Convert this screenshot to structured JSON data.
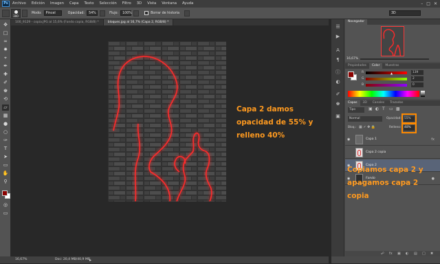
{
  "app": {
    "logo": "Ps"
  },
  "menu": [
    "Archivo",
    "Edición",
    "Imagen",
    "Capa",
    "Texto",
    "Selección",
    "Filtro",
    "3D",
    "Vista",
    "Ventana",
    "Ayuda"
  ],
  "options": {
    "brush_size": "300",
    "mode_label": "Modo:",
    "mode_value": "Pincel",
    "opacity_label": "Opacidad:",
    "opacity_value": "54%",
    "flow_label": "Flujo:",
    "flow_value": "100%",
    "erase_history_label": "Borrar de historia",
    "workspace_value": "3D"
  },
  "tabs": [
    {
      "label": "100_9129 - copia.JPG al 15,6% (Fondo copia, RGB/8) *"
    },
    {
      "label": "bloques.jpg al 16,7% (Capa 2, RGB/8) *"
    }
  ],
  "status": {
    "zoom": "16,67%",
    "doc": "Doc: 20,4 MB/40,9 MB"
  },
  "annotations": {
    "top": [
      "Capa 2 damos",
      "opacidad de 55% y",
      "relleno 40%"
    ],
    "bottom": [
      "Copiamos capa 2 y",
      "apagamos capa 2",
      "copia"
    ]
  },
  "navigator": {
    "title": "Navegador",
    "zoom": "16,67%"
  },
  "color_panel": {
    "tabs": [
      "Propiedades",
      "Color",
      "Muestras"
    ],
    "r_label": "R",
    "r_value": "139",
    "g_label": "G",
    "g_value": "2",
    "b_label": "B",
    "b_value": "0",
    "fg_color": "#8b0200",
    "bg_color": "#ffffff"
  },
  "layers_panel": {
    "tabs": [
      "Capas",
      "3D",
      "Canales",
      "Trazados"
    ],
    "kind_label": "Tipo",
    "blend_mode": "Normal",
    "opacity_label": "Opacidad:",
    "opacity_value": "55%",
    "lock_label": "Bloq.:",
    "fill_label": "Relleno:",
    "fill_value": "40%",
    "layers": [
      {
        "name": "Capa 1",
        "visible": true,
        "selected": false
      },
      {
        "name": "Capa 2 copia",
        "visible": false,
        "selected": false
      },
      {
        "name": "Capa 2",
        "visible": true,
        "selected": true
      },
      {
        "name": "Fondo",
        "visible": true,
        "selected": false
      }
    ]
  },
  "colors": {
    "accent_orange": "#ff9a1f",
    "neon_red": "#ff2a2a",
    "selected_layer": "#596478"
  }
}
